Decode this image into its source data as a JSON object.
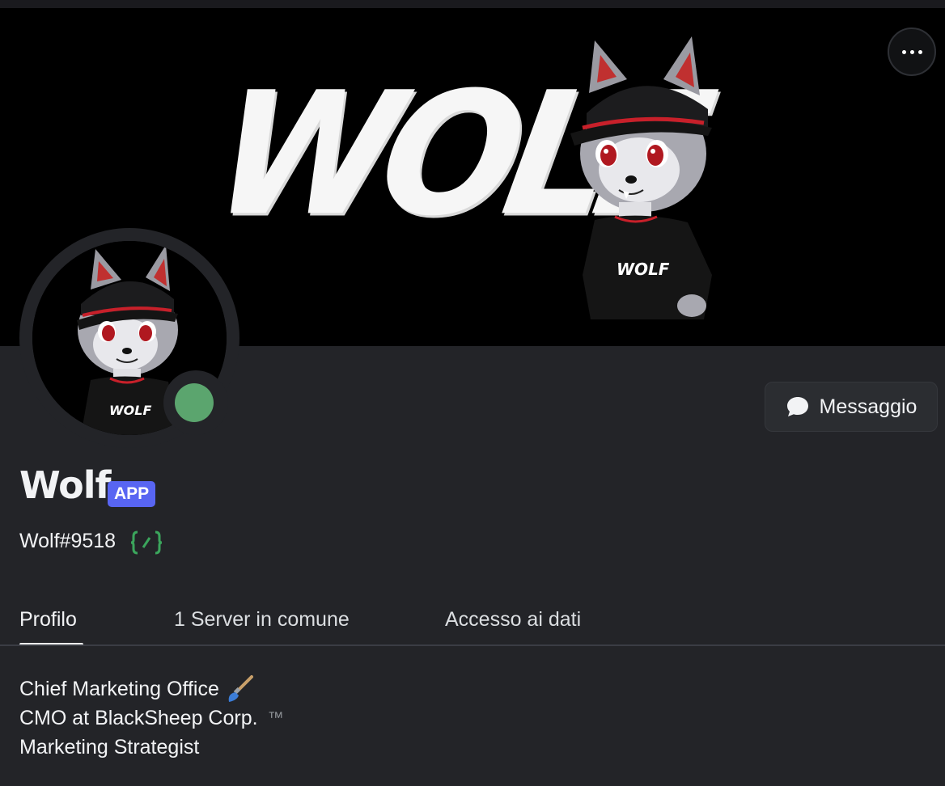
{
  "banner": {
    "text": "WOLF",
    "shirt_text": "WOLF"
  },
  "header": {
    "more_label": "•••"
  },
  "profile": {
    "display_name": "Wolf",
    "badge": "APP",
    "username": "Wolf#9518",
    "status": "online",
    "status_color": "#5ba56e",
    "badge_color": "#5865f2"
  },
  "actions": {
    "message_label": "Messaggio"
  },
  "tabs": [
    {
      "label": "Profilo",
      "active": true
    },
    {
      "label": "1 Server in comune",
      "active": false
    },
    {
      "label": "Accesso ai dati",
      "active": false
    }
  ],
  "bio": {
    "lines": [
      "Chief Marketing Office",
      "CMO at BlackSheep Corp.",
      "Marketing Strategist"
    ],
    "tm": "™"
  },
  "icons": {
    "more": "ellipsis-icon",
    "message": "chat-bubble-icon",
    "command": "slash-command-icon",
    "brush": "paintbrush-icon"
  }
}
